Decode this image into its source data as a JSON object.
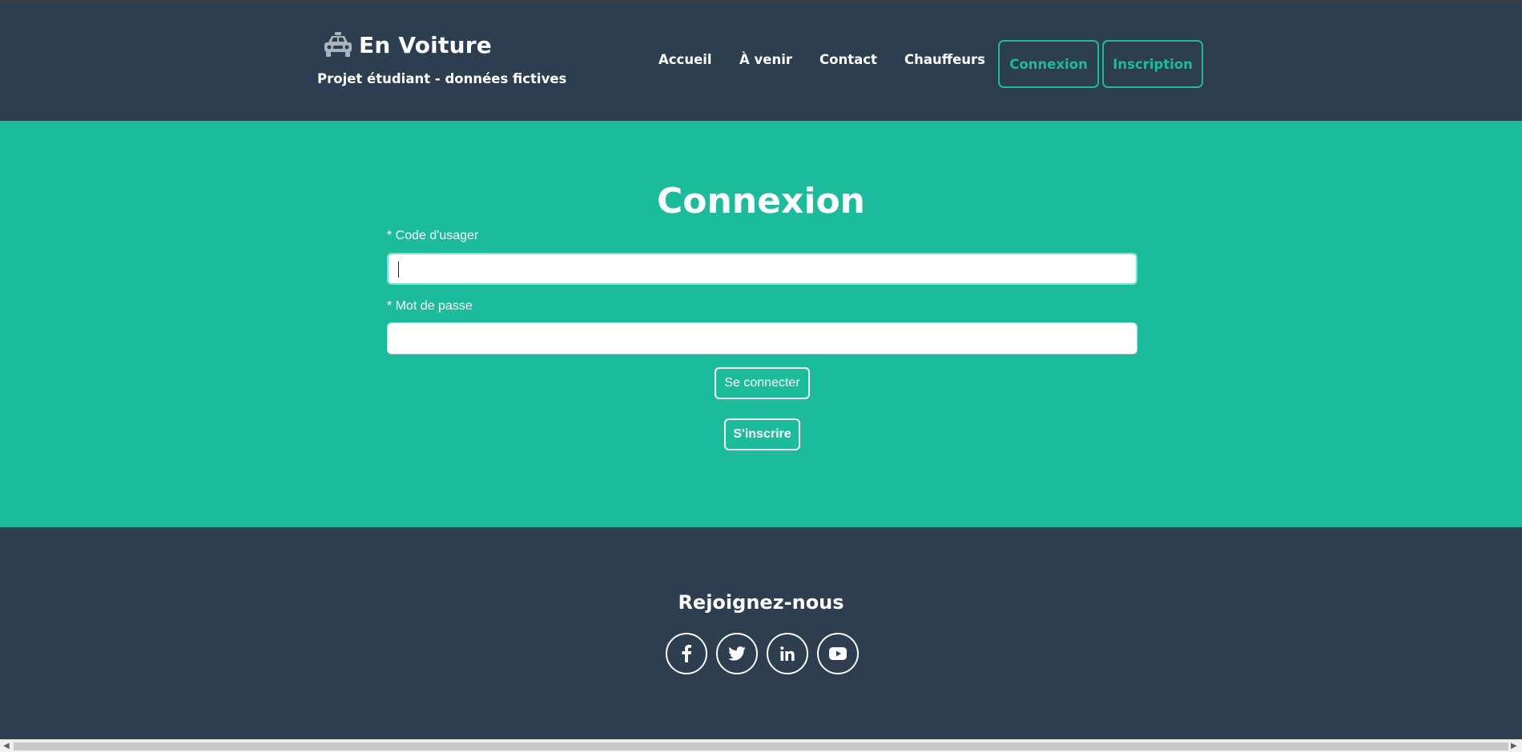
{
  "header": {
    "brand_title": "En Voiture",
    "brand_subtitle": "Projet étudiant - données fictives",
    "brand_icon": "taxi-icon",
    "nav": {
      "accueil": "Accueil",
      "a_venir": "À venir",
      "contact": "Contact",
      "chauffeurs": "Chauffeurs",
      "connexion": "Connexion",
      "inscription": "Inscription"
    }
  },
  "main": {
    "title": "Connexion",
    "username_label": "* Code d'usager",
    "username_value": "",
    "password_label": "* Mot de passe",
    "password_value": "",
    "login_button": "Se connecter",
    "register_button": "S'inscrire"
  },
  "footer": {
    "title": "Rejoignez-nous",
    "social": [
      "facebook-icon",
      "twitter-icon",
      "linkedin-icon",
      "youtube-icon"
    ]
  },
  "colors": {
    "navy": "#2c3e50",
    "teal": "#1abc9c",
    "white": "#ffffff"
  }
}
